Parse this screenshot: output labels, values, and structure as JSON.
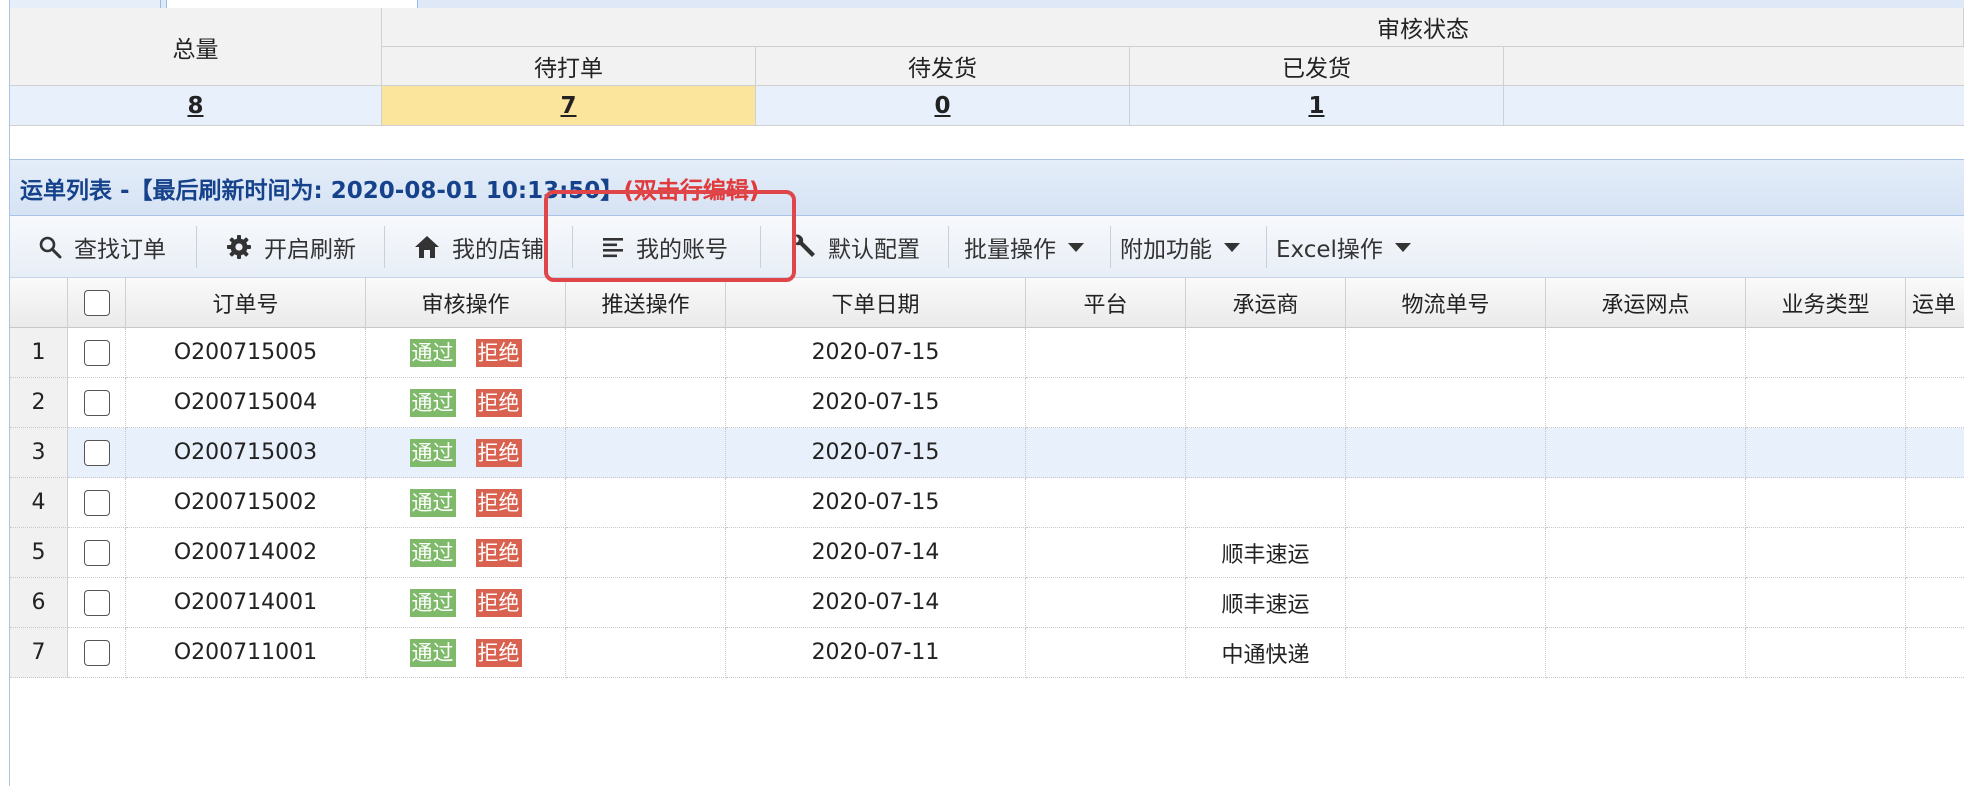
{
  "summary": {
    "total_label": "总量",
    "status_group_label": "审核状态",
    "columns": [
      "待打单",
      "待发货",
      "已发货"
    ],
    "total_value": "8",
    "values": [
      "7",
      "0",
      "1"
    ]
  },
  "list_title": {
    "prefix": "运单列表 -【最后刷新时间为: 2020-08-01 10:13:50】",
    "hint": "(双击行编辑)"
  },
  "toolbar": {
    "find_order": "查找订单",
    "auto_refresh": "开启刷新",
    "my_shop": "我的店铺",
    "my_account": "我的账号",
    "default_config": "默认配置",
    "batch_ops": "批量操作",
    "extra_features": "附加功能",
    "excel_ops": "Excel操作"
  },
  "grid": {
    "headers": [
      "订单号",
      "审核操作",
      "推送操作",
      "下单日期",
      "平台",
      "承运商",
      "物流单号",
      "承运网点",
      "业务类型",
      "运单"
    ],
    "pass_label": "通过",
    "reject_label": "拒绝",
    "rows": [
      {
        "num": "1",
        "order": "O200715005",
        "date": "2020-07-15",
        "carrier": ""
      },
      {
        "num": "2",
        "order": "O200715004",
        "date": "2020-07-15",
        "carrier": ""
      },
      {
        "num": "3",
        "order": "O200715003",
        "date": "2020-07-15",
        "carrier": ""
      },
      {
        "num": "4",
        "order": "O200715002",
        "date": "2020-07-15",
        "carrier": ""
      },
      {
        "num": "5",
        "order": "O200714002",
        "date": "2020-07-14",
        "carrier": "顺丰速运"
      },
      {
        "num": "6",
        "order": "O200714001",
        "date": "2020-07-14",
        "carrier": "顺丰速运"
      },
      {
        "num": "7",
        "order": "O200711001",
        "date": "2020-07-11",
        "carrier": "中通快递"
      }
    ]
  },
  "colors": {
    "highlight": "#e0454a",
    "pass": "#7fba6b",
    "reject": "#d9614f",
    "summary_highlight": "#fbe59d",
    "title_text": "#15428b"
  }
}
